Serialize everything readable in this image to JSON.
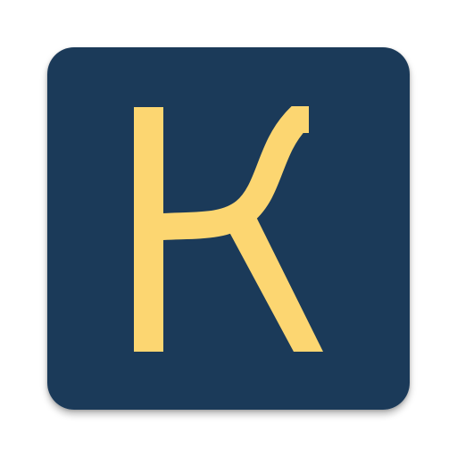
{
  "app_icon": {
    "icon_name": "k-logo-icon",
    "colors": {
      "background": "#1B3A59",
      "glyph": "#FCD671"
    }
  }
}
